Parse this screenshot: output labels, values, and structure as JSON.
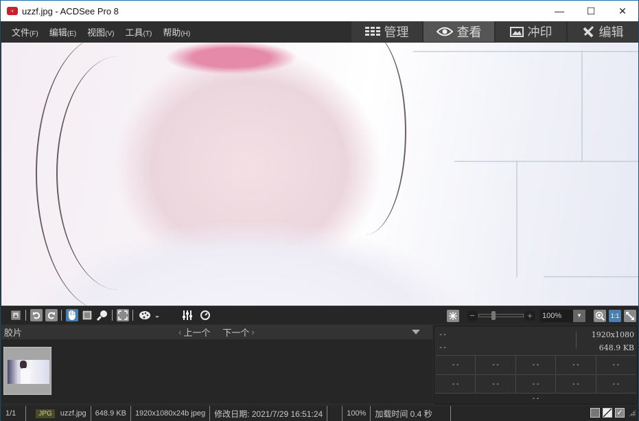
{
  "window": {
    "title": "uzzf.jpg - ACDSee Pro 8",
    "controls": {
      "minimize": "—",
      "maximize": "☐",
      "close": "✕"
    }
  },
  "menu": [
    {
      "label": "文件",
      "accel": "(F)"
    },
    {
      "label": "编辑",
      "accel": "(E)"
    },
    {
      "label": "视图",
      "accel": "(V)"
    },
    {
      "label": "工具",
      "accel": "(T)"
    },
    {
      "label": "帮助",
      "accel": "(H)"
    }
  ],
  "mode_tabs": [
    {
      "label": "管理",
      "icon": "grid-icon",
      "active": false
    },
    {
      "label": "查看",
      "icon": "eye-icon",
      "active": true
    },
    {
      "label": "冲印",
      "icon": "picture-icon",
      "active": false
    },
    {
      "label": "编辑",
      "icon": "tools-icon",
      "active": false
    }
  ],
  "toolbar": {
    "tools": [
      "image-browse",
      "rotate-left",
      "rotate-right",
      "hand-pan",
      "select-rectangle",
      "zoom-magnifier",
      "fit-screen",
      "color-palette",
      "dropdown",
      "adjust-sliders",
      "circle-timer"
    ],
    "active_tool": "hand-pan",
    "zoom": {
      "minus": "−",
      "plus": "+",
      "value": "100%",
      "slider_fraction": 0.3
    },
    "actual_size_label": "1:1"
  },
  "filmstrip": {
    "title": "胶片",
    "prev_label": "上一个",
    "next_label": "下一个",
    "prev_chevron": "‹",
    "next_chevron": "›"
  },
  "info_panel": {
    "line1_left": "--",
    "line2_left": "--",
    "resolution": "1920x1080",
    "filesize": "648.9 KB",
    "row1": [
      "--",
      "--",
      "--",
      "--",
      "--"
    ],
    "row2": [
      "--",
      "--",
      "--",
      "--",
      "--"
    ],
    "bottom": "--"
  },
  "statusbar": {
    "index": "1/1",
    "format_badge": "JPG",
    "filename": "uzzf.jpg",
    "filesize": "648.9 KB",
    "dimensions": "1920x1080x24b jpeg",
    "modified": "修改日期: 2021/7/29 16:51:24",
    "zoom": "100%",
    "load_time": "加载时间 0.4 秒"
  }
}
